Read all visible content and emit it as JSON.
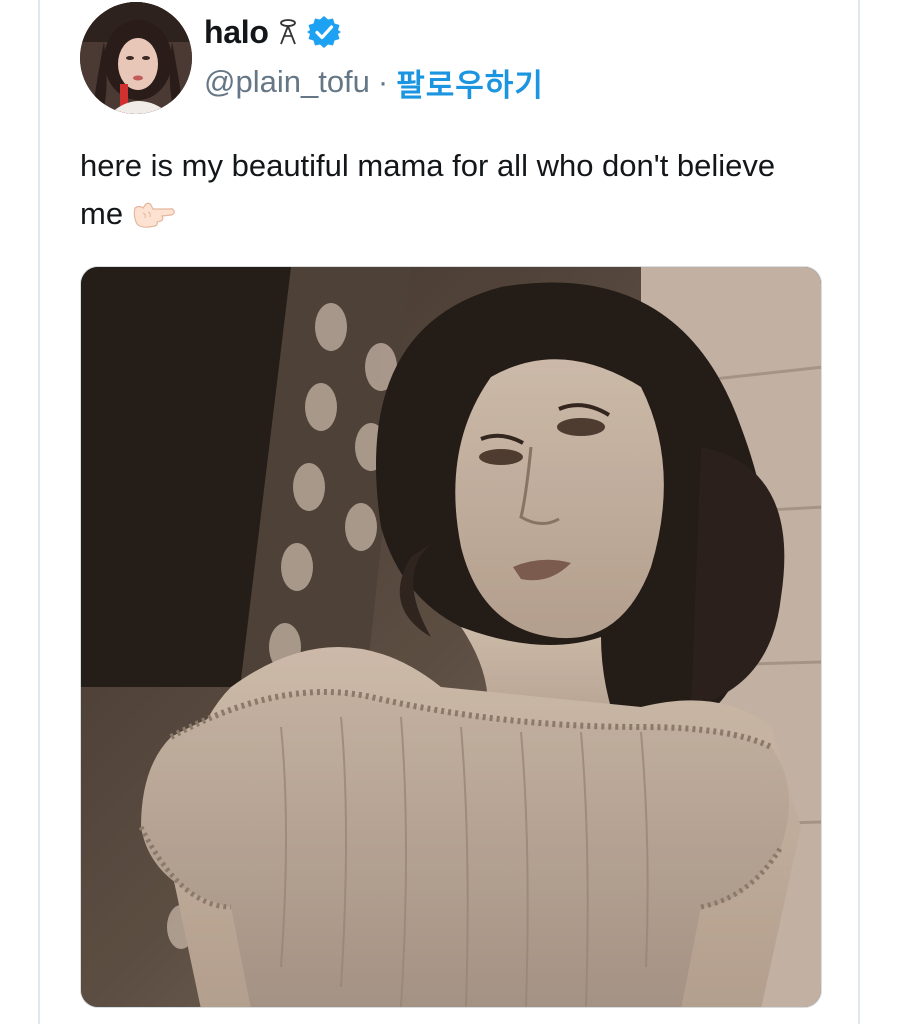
{
  "tweet": {
    "author": {
      "display_name": "halo",
      "name_emoji_icon": "halo-hanging-icon",
      "verified_icon": "verified-badge-icon",
      "handle": "@plain_tofu",
      "separator": "·",
      "follow_label": "팔로우하기",
      "avatar_icon": "user-avatar"
    },
    "text": "here is my beautiful mama for all who don't believe me",
    "text_emoji_icon": "pointing-hand-icon",
    "media": {
      "type": "photo",
      "description_icon": "sepia-portrait-photo"
    }
  },
  "colors": {
    "text": "#14171a",
    "secondary": "#657786",
    "link": "#1b95e0",
    "verified": "#1da1f2",
    "border": "#e1e8ed"
  }
}
